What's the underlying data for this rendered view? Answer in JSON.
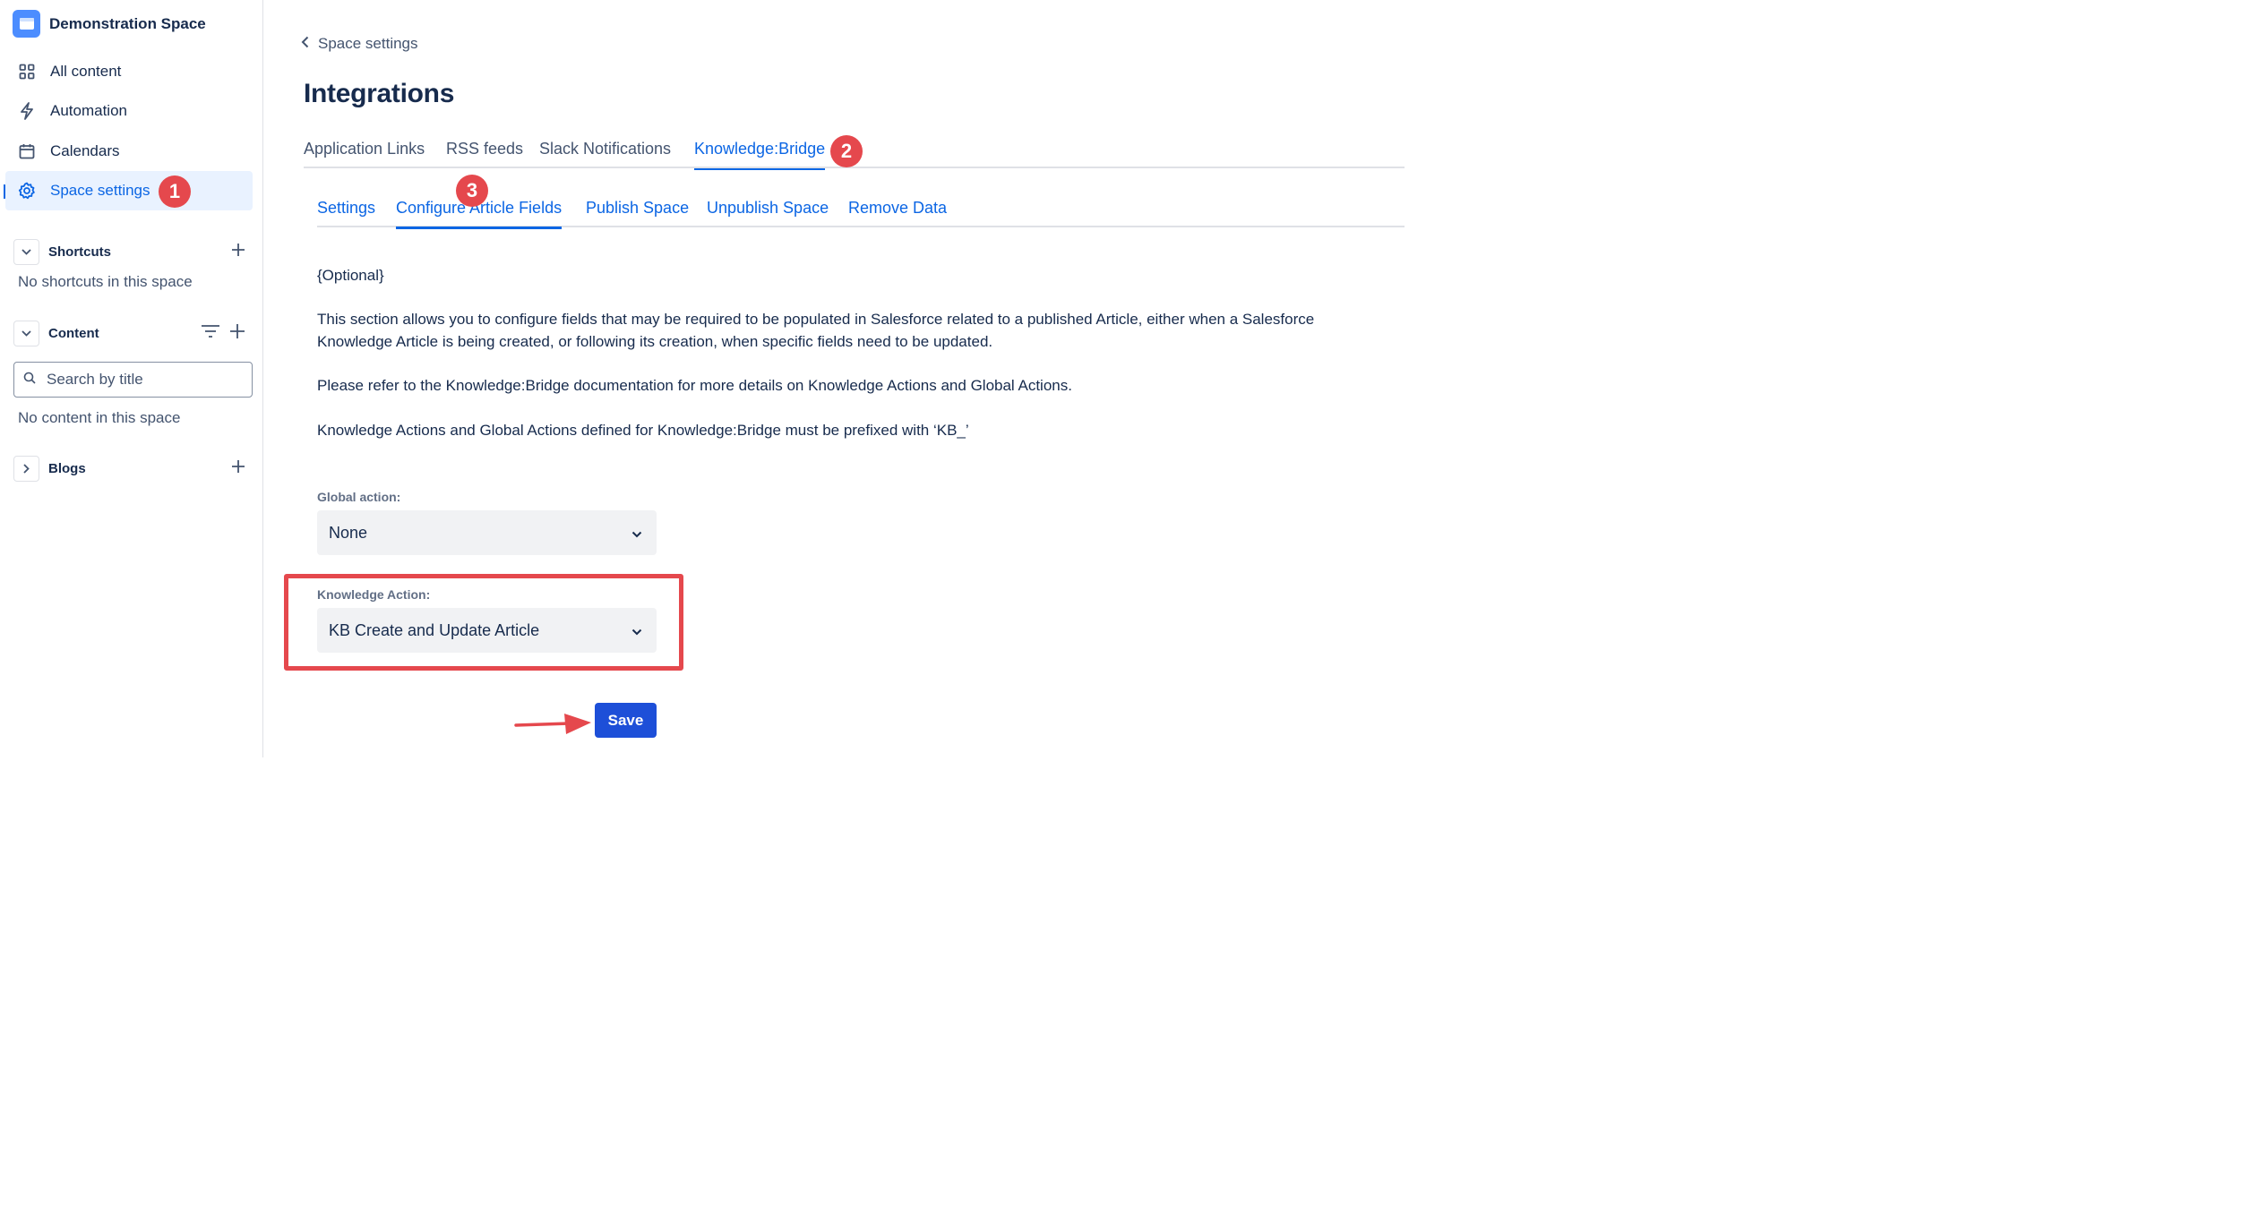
{
  "sidebar": {
    "space_name": "Demonstration Space",
    "nav": [
      {
        "label": "All content",
        "icon": "grid-icon"
      },
      {
        "label": "Automation",
        "icon": "lightning-icon"
      },
      {
        "label": "Calendars",
        "icon": "calendar-icon"
      },
      {
        "label": "Space settings",
        "icon": "gear-icon",
        "active": true
      }
    ],
    "shortcuts": {
      "label": "Shortcuts",
      "empty_text": "No shortcuts in this space"
    },
    "content": {
      "label": "Content",
      "search_placeholder": "Search by title",
      "empty_text": "No content in this space"
    },
    "blogs": {
      "label": "Blogs"
    }
  },
  "main": {
    "back_label": "Space settings",
    "title": "Integrations",
    "tabs": [
      {
        "label": "Application Links"
      },
      {
        "label": "RSS feeds"
      },
      {
        "label": "Slack Notifications"
      },
      {
        "label": "Knowledge:Bridge",
        "active": true
      }
    ],
    "subtabs": [
      {
        "label": "Settings"
      },
      {
        "label": "Configure Article Fields",
        "active": true
      },
      {
        "label": "Publish Space"
      },
      {
        "label": "Unpublish Space"
      },
      {
        "label": "Remove Data"
      }
    ],
    "optional_text": "{Optional}",
    "paragraph1_line1": "This section allows you to configure fields that may be required to be populated in Salesforce related to a published Article, either when a Salesforce",
    "paragraph1_line2": "Knowledge Article is being created, or following its creation, when specific fields need to be updated.",
    "paragraph2": "Please refer to the Knowledge:Bridge documentation for more details on Knowledge Actions and Global Actions.",
    "paragraph3": "Knowledge Actions and Global Actions defined for Knowledge:Bridge must be prefixed with ‘KB_’",
    "global_action": {
      "label": "Global action:",
      "value": "None"
    },
    "knowledge_action": {
      "label": "Knowledge Action:",
      "value": "KB Create and Update Article"
    },
    "save_label": "Save"
  },
  "markers": [
    "1",
    "2",
    "3"
  ],
  "colors": {
    "accent": "#0c66e4",
    "marker": "#e5484d",
    "save_button": "#1d4fd8"
  }
}
